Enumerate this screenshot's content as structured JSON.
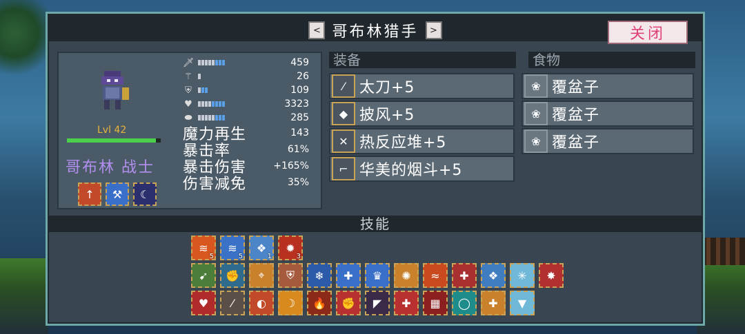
{
  "panel": {
    "title": "哥布林猎手",
    "prev_arrow": "<",
    "next_arrow": ">",
    "close_label": "关闭"
  },
  "character": {
    "level": "Lvl 42",
    "name": "哥布林 战士",
    "hp_fraction": 0.95,
    "stats": [
      {
        "icon": "sword-icon",
        "glyph": "🗡",
        "pips": 8,
        "blue": 3,
        "value": "459"
      },
      {
        "icon": "wand-icon",
        "glyph": "⚚",
        "pips": 1,
        "blue": 0,
        "value": "26"
      },
      {
        "icon": "shield-icon",
        "glyph": "⛨",
        "pips": 3,
        "blue": 2,
        "value": "109"
      },
      {
        "icon": "heart-icon",
        "glyph": "♥",
        "pips": 8,
        "blue": 4,
        "value": "3323"
      },
      {
        "icon": "boot-icon",
        "glyph": "⬬",
        "pips": 8,
        "blue": 3,
        "value": "285"
      }
    ],
    "attributes": [
      {
        "label": "魔力再生",
        "value": "143"
      },
      {
        "label": "暴击率",
        "value": "61%"
      },
      {
        "label": "暴击伤害",
        "value": "+165%"
      },
      {
        "label": "伤害减免",
        "value": "35%"
      }
    ],
    "buffs": [
      {
        "icon": "power-up-icon",
        "glyph": "↑",
        "color": "#c24a2a"
      },
      {
        "icon": "axe-shield-icon",
        "glyph": "⚒",
        "color": "#3a6fc9"
      },
      {
        "icon": "moon-icon",
        "glyph": "☾",
        "color": "#2b2f6e"
      }
    ]
  },
  "equipment": {
    "header": "装备",
    "items": [
      {
        "icon": "katana-icon",
        "glyph": "⁄",
        "label": "太刀+5"
      },
      {
        "icon": "cloak-icon",
        "glyph": "◆",
        "label": "披风+5"
      },
      {
        "icon": "reactive-armor-icon",
        "glyph": "✕",
        "label": "热反应堆+5"
      },
      {
        "icon": "pipe-icon",
        "glyph": "⌐",
        "label": "华美的烟斗+5"
      }
    ]
  },
  "food": {
    "header": "食物",
    "items": [
      {
        "icon": "raspberry-icon",
        "glyph": "❀",
        "label": "覆盆子"
      },
      {
        "icon": "raspberry-icon",
        "glyph": "❀",
        "label": "覆盆子"
      },
      {
        "icon": "raspberry-icon",
        "glyph": "❀",
        "label": "覆盆子"
      }
    ]
  },
  "skills": {
    "header": "技能",
    "rows": [
      [
        {
          "icon": "fire-dash-icon",
          "glyph": "≋",
          "color": "#d8571f",
          "count": "5"
        },
        {
          "icon": "ice-dash-icon",
          "glyph": "≋",
          "color": "#3a72c8",
          "count": "5"
        },
        {
          "icon": "frost-rune-icon",
          "glyph": "❖",
          "color": "#4d86c8",
          "count": "1"
        },
        {
          "icon": "fire-burst-icon",
          "glyph": "✹",
          "color": "#b8301f",
          "count": "3"
        }
      ],
      [
        {
          "icon": "poison-arrow-icon",
          "glyph": "➹",
          "color": "#4c7d3a",
          "count": ""
        },
        {
          "icon": "frost-fist-icon",
          "glyph": "✊",
          "color": "#2f6b8c",
          "count": ""
        },
        {
          "icon": "targeting-icon",
          "glyph": "⌖",
          "color": "#c9822b",
          "count": ""
        },
        {
          "icon": "shield-crest-icon",
          "glyph": "⛨",
          "color": "#a55a3e",
          "count": ""
        },
        {
          "icon": "blue-swirl-icon",
          "glyph": "❄",
          "color": "#2b5aa8",
          "count": ""
        },
        {
          "icon": "ice-blade-plus-icon",
          "glyph": "✚",
          "color": "#3a6fc9",
          "count": ""
        },
        {
          "icon": "crown-icon",
          "glyph": "♛",
          "color": "#3a6fc9",
          "count": ""
        },
        {
          "icon": "gear-burst-icon",
          "glyph": "✺",
          "color": "#c9822b",
          "count": ""
        },
        {
          "icon": "fire-wave-icon",
          "glyph": "≈",
          "color": "#c94a1f",
          "count": ""
        },
        {
          "icon": "claw-plus-icon",
          "glyph": "✚",
          "color": "#a83030",
          "count": ""
        },
        {
          "icon": "frost-rune-icon",
          "glyph": "❖",
          "color": "#3f7cc0",
          "count": ""
        },
        {
          "icon": "ice-star-icon",
          "glyph": "✳",
          "color": "#6fb8d8",
          "count": ""
        },
        {
          "icon": "red-burst-icon",
          "glyph": "✸",
          "color": "#b33030",
          "count": ""
        }
      ],
      [
        {
          "icon": "heart-burst-icon",
          "glyph": "♥",
          "color": "#b02c2c",
          "count": ""
        },
        {
          "icon": "dagger-icon",
          "glyph": "⁄",
          "color": "#5a5048",
          "count": ""
        },
        {
          "icon": "fire-ice-orb-icon",
          "glyph": "◐",
          "color": "#c24a2a",
          "count": ""
        },
        {
          "icon": "crescent-icon",
          "glyph": "☽",
          "color": "#d88a1f",
          "count": ""
        },
        {
          "icon": "flame-icon",
          "glyph": "🔥",
          "color": "#8c2a1a",
          "count": ""
        },
        {
          "icon": "fire-fist-icon",
          "glyph": "✊",
          "color": "#b83030",
          "count": ""
        },
        {
          "icon": "shadow-cat-icon",
          "glyph": "◤",
          "color": "#3a2a4a",
          "count": ""
        },
        {
          "icon": "downward-plus-icon",
          "glyph": "✚",
          "color": "#b83030",
          "count": ""
        },
        {
          "icon": "grid-icon",
          "glyph": "▦",
          "color": "#8c1f1f",
          "count": ""
        },
        {
          "icon": "ring-icon",
          "glyph": "◯",
          "color": "#1f8c8c",
          "count": ""
        },
        {
          "icon": "sword-plus-icon",
          "glyph": "✚",
          "color": "#c9822b",
          "count": ""
        },
        {
          "icon": "icicle-icon",
          "glyph": "▼",
          "color": "#6fb8d8",
          "count": ""
        }
      ]
    ]
  }
}
